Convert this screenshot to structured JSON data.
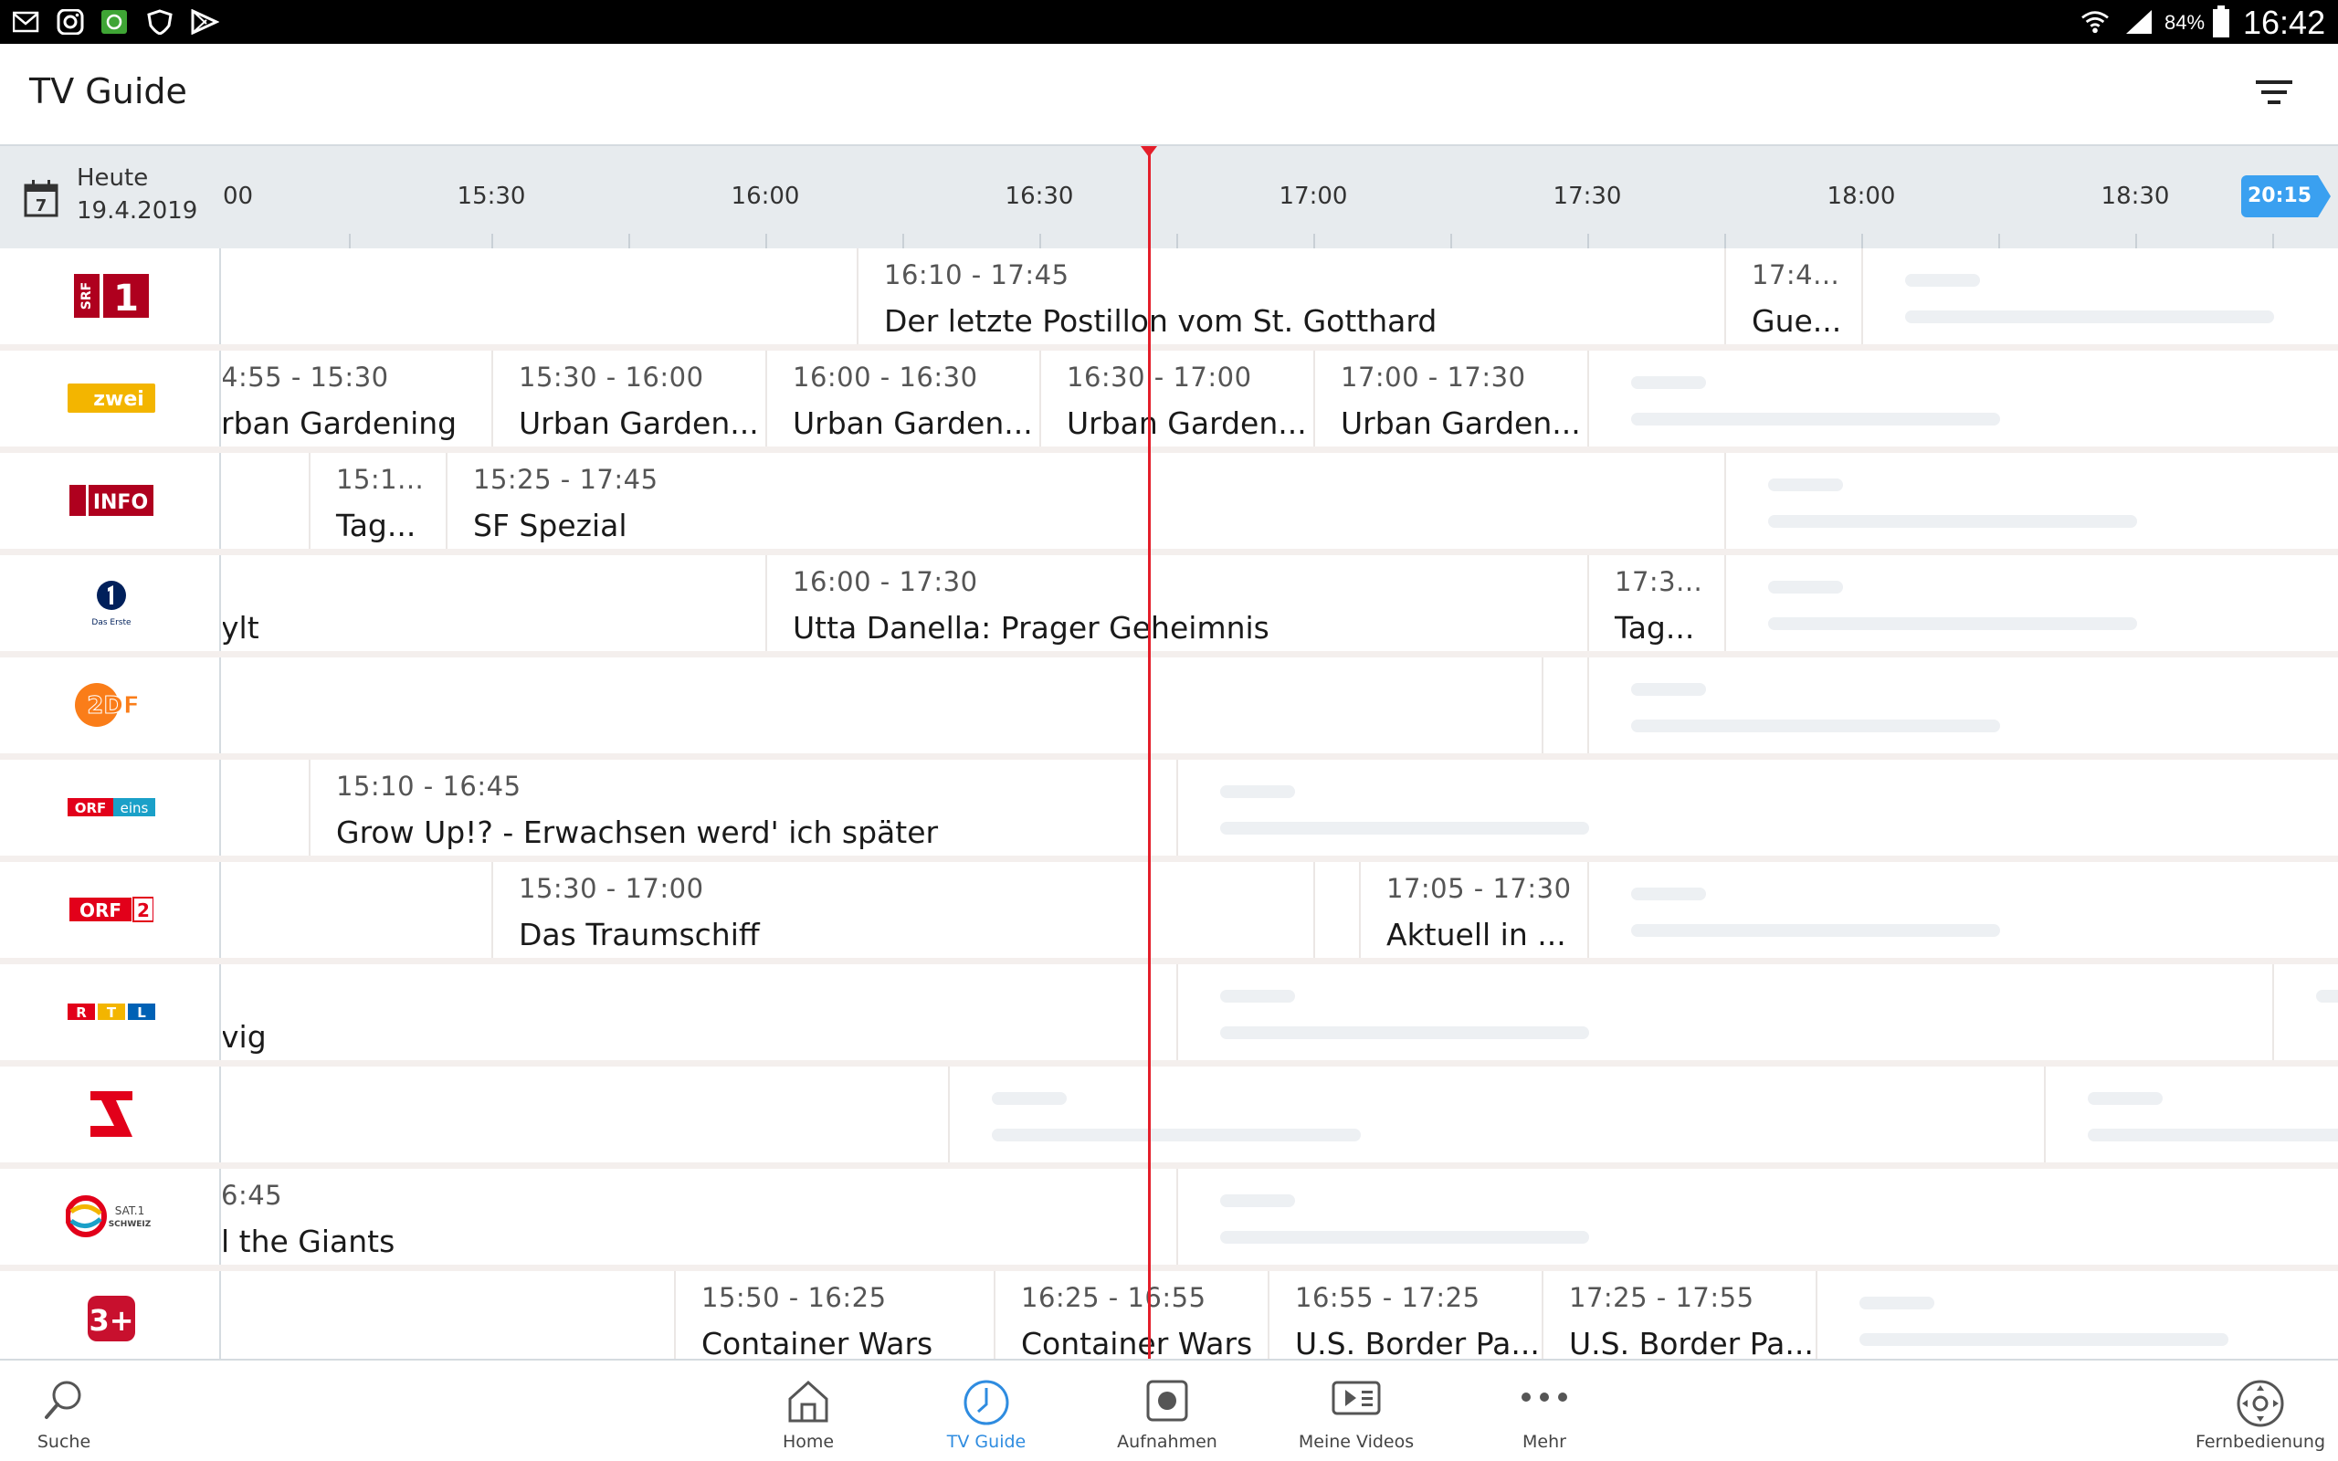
{
  "status_bar": {
    "battery": "84%",
    "time": "16:42",
    "icons": [
      "mail-icon",
      "instagram-icon",
      "app-icon",
      "shield-icon",
      "play-store-icon",
      "wifi-icon",
      "signal-icon",
      "battery-icon"
    ]
  },
  "header": {
    "title": "TV Guide",
    "filter_icon": "filter-icon"
  },
  "timeline": {
    "day": "Heute",
    "date": "19.4.2019",
    "calendar_day": "7",
    "times": [
      "00",
      "15:30",
      "16:00",
      "16:30",
      "17:00",
      "17:30",
      "18:00",
      "18:30"
    ],
    "now_button": "20:15"
  },
  "channels": [
    {
      "name": "SRF 1",
      "programs": [
        {
          "time": "16:10 - 17:45",
          "title": "Der letzte Postillon vom St. Gotthard"
        },
        {
          "time": "17:4...",
          "title": "Gue..."
        }
      ]
    },
    {
      "name": "SRF zwei",
      "programs": [
        {
          "time": "4:55 - 15:30",
          "title": "rban Gardening"
        },
        {
          "time": "15:30 - 16:00",
          "title": "Urban Garden..."
        },
        {
          "time": "16:00 - 16:30",
          "title": "Urban Garden..."
        },
        {
          "time": "16:30 - 17:00",
          "title": "Urban Garden..."
        },
        {
          "time": "17:00 - 17:30",
          "title": "Urban Garden..."
        }
      ]
    },
    {
      "name": "SRF info",
      "programs": [
        {
          "time": "15:1...",
          "title": "Tag..."
        },
        {
          "time": "15:25 - 17:45",
          "title": "SF Spezial"
        }
      ]
    },
    {
      "name": "Das Erste",
      "programs": [
        {
          "time": "",
          "title": "ylt"
        },
        {
          "time": "16:00 - 17:30",
          "title": "Utta Danella: Prager Geheimnis"
        },
        {
          "time": "17:3...",
          "title": "Tag..."
        }
      ]
    },
    {
      "name": "ZDF",
      "programs": []
    },
    {
      "name": "ORF eins",
      "programs": [
        {
          "time": "15:10 - 16:45",
          "title": "Grow Up!? - Erwachsen werd' ich später"
        }
      ]
    },
    {
      "name": "ORF 2",
      "programs": [
        {
          "time": "15:30 - 17:00",
          "title": "Das Traumschiff"
        },
        {
          "time": "17:05 - 17:30",
          "title": "Aktuell in ..."
        }
      ]
    },
    {
      "name": "RTL",
      "programs": [
        {
          "time": "",
          "title": "vig"
        }
      ]
    },
    {
      "name": "ProSieben",
      "programs": []
    },
    {
      "name": "SAT.1 Schweiz",
      "programs": [
        {
          "time": "6:45",
          "title": "l the Giants"
        }
      ]
    },
    {
      "name": "3+",
      "programs": [
        {
          "time": "15:50 - 16:25",
          "title": "Container Wars"
        },
        {
          "time": "16:25 - 16:55",
          "title": "Container Wars"
        },
        {
          "time": "16:55 - 17:25",
          "title": "U.S. Border Pa..."
        },
        {
          "time": "17:25 - 17:55",
          "title": "U.S. Border Pa..."
        }
      ]
    }
  ],
  "logos": {
    "srf1": "1",
    "srf1_small": "SRF",
    "srfzwei": "zwei",
    "srfinfo": "INFO",
    "daserste": "Das Erste",
    "zdf": "2DF",
    "orfeins_a": "ORF",
    "orfeins_b": "eins",
    "orf2_a": "ORF",
    "orf2_b": "2",
    "rtl": [
      "R",
      "T",
      "L"
    ],
    "sat1": "SAT.1",
    "sat1_b": "SCHWEIZ",
    "threeplus": "3+"
  },
  "bottom_nav": [
    {
      "label": "Suche",
      "icon": "search-icon"
    },
    {
      "label": "Home",
      "icon": "home-icon"
    },
    {
      "label": "TV Guide",
      "icon": "clock-icon",
      "active": true
    },
    {
      "label": "Aufnahmen",
      "icon": "record-icon"
    },
    {
      "label": "Meine Videos",
      "icon": "videos-icon"
    },
    {
      "label": "Mehr",
      "icon": "more-icon"
    },
    {
      "label": "Fernbedienung",
      "icon": "remote-icon"
    }
  ],
  "colors": {
    "accent": "#2f8ce0",
    "now_line": "#e41e2a",
    "badge": "#3aa0f0"
  }
}
